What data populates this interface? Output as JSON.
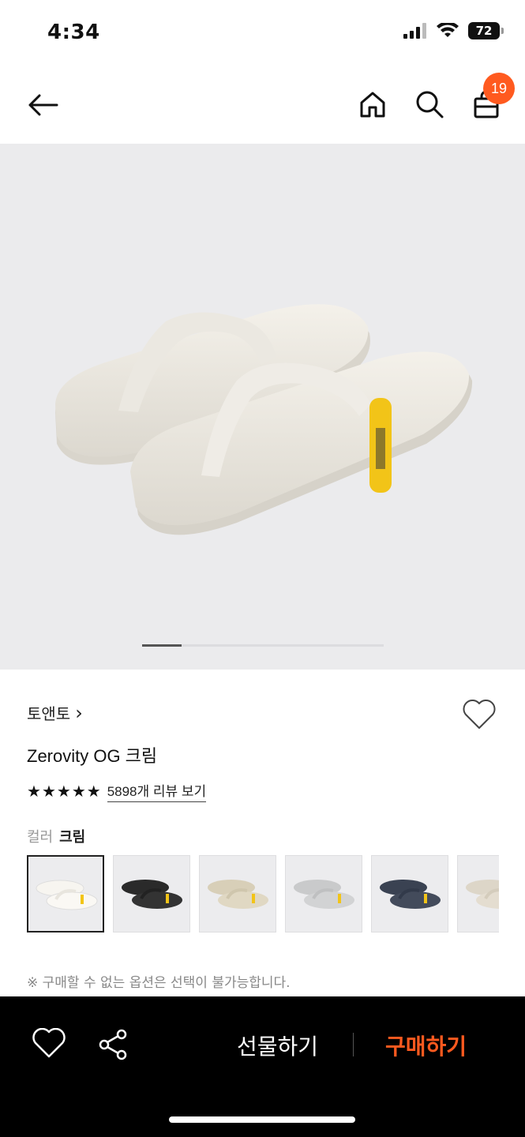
{
  "status": {
    "time": "4:34",
    "battery": "72"
  },
  "header": {
    "cart_count": "19",
    "icons": [
      "back-arrow-icon",
      "home-icon",
      "search-icon",
      "shopping-bag-icon"
    ]
  },
  "product": {
    "brand": "토앤토",
    "brand_chevron": "›",
    "name": "Zerovity OG 크림",
    "rating_stars": 5,
    "reviews_link": "5898개 리뷰 보기",
    "color_label": "컬러",
    "color_value": "크림",
    "image_pager": {
      "total": 6,
      "current": 1
    },
    "swatches": [
      {
        "color": "cream",
        "selected": true
      },
      {
        "color": "black",
        "selected": false
      },
      {
        "color": "beige",
        "selected": false
      },
      {
        "color": "gray",
        "selected": false
      },
      {
        "color": "navy",
        "selected": false
      },
      {
        "color": "sand",
        "selected": false
      }
    ],
    "notice": "※ 구매할 수 없는 옵션은 선택이 불가능합니다."
  },
  "bottom_bar": {
    "gift_label": "선물하기",
    "buy_label": "구매하기"
  },
  "colors": {
    "accent": "#ff5a1f",
    "background_image": "#ebebed",
    "bottom_bar": "#000000",
    "strap_yellow": "#f2c418"
  }
}
